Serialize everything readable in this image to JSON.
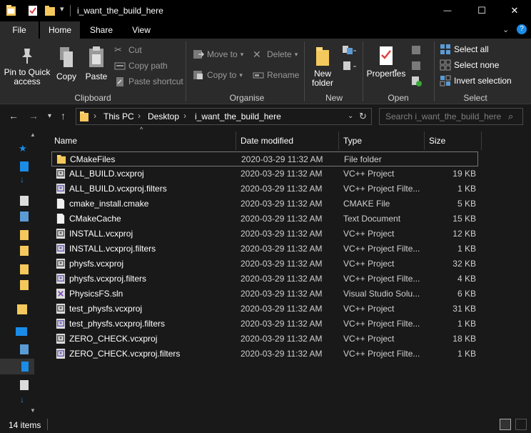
{
  "window": {
    "title": "i_want_the_build_here",
    "minimize_glyph": "—",
    "maximize_glyph": "☐",
    "close_glyph": "✕"
  },
  "ribbon_tabs": {
    "file": "File",
    "home": "Home",
    "share": "Share",
    "view": "View"
  },
  "clipboard": {
    "pin_label_1": "Pin to Quick",
    "pin_label_2": "access",
    "copy": "Copy",
    "paste": "Paste",
    "cut": "Cut",
    "copy_path": "Copy path",
    "paste_shortcut": "Paste shortcut",
    "group": "Clipboard"
  },
  "organise": {
    "move_to": "Move to",
    "copy_to": "Copy to",
    "delete": "Delete",
    "rename": "Rename",
    "group": "Organise"
  },
  "new_group": {
    "new_folder_1": "New",
    "new_folder_2": "folder",
    "group": "New"
  },
  "open_group": {
    "properties": "Properties",
    "group": "Open"
  },
  "select_group": {
    "select_all": "Select all",
    "select_none": "Select none",
    "invert_selection": "Invert selection",
    "group": "Select"
  },
  "address": {
    "crumbs": [
      "This PC",
      "Desktop",
      "i_want_the_build_here"
    ],
    "search_placeholder": "Search i_want_the_build_here"
  },
  "columns": {
    "name": "Name",
    "date_modified": "Date modified",
    "type": "Type",
    "size": "Size"
  },
  "files": [
    {
      "name": "CMakeFiles",
      "date": "2020-03-29 11:32 AM",
      "type": "File folder",
      "size": "",
      "icon": "folder-icon"
    },
    {
      "name": "ALL_BUILD.vcxproj",
      "date": "2020-03-29 11:32 AM",
      "type": "VC++ Project",
      "size": "19 KB",
      "icon": "vcxproj-icon"
    },
    {
      "name": "ALL_BUILD.vcxproj.filters",
      "date": "2020-03-29 11:32 AM",
      "type": "VC++ Project Filte...",
      "size": "1 KB",
      "icon": "filters-icon"
    },
    {
      "name": "cmake_install.cmake",
      "date": "2020-03-29 11:32 AM",
      "type": "CMAKE File",
      "size": "5 KB",
      "icon": "document-icon"
    },
    {
      "name": "CMakeCache",
      "date": "2020-03-29 11:32 AM",
      "type": "Text Document",
      "size": "15 KB",
      "icon": "document-icon"
    },
    {
      "name": "INSTALL.vcxproj",
      "date": "2020-03-29 11:32 AM",
      "type": "VC++ Project",
      "size": "12 KB",
      "icon": "vcxproj-icon"
    },
    {
      "name": "INSTALL.vcxproj.filters",
      "date": "2020-03-29 11:32 AM",
      "type": "VC++ Project Filte...",
      "size": "1 KB",
      "icon": "filters-icon"
    },
    {
      "name": "physfs.vcxproj",
      "date": "2020-03-29 11:32 AM",
      "type": "VC++ Project",
      "size": "32 KB",
      "icon": "vcxproj-icon"
    },
    {
      "name": "physfs.vcxproj.filters",
      "date": "2020-03-29 11:32 AM",
      "type": "VC++ Project Filte...",
      "size": "4 KB",
      "icon": "filters-icon"
    },
    {
      "name": "PhysicsFS.sln",
      "date": "2020-03-29 11:32 AM",
      "type": "Visual Studio Solu...",
      "size": "6 KB",
      "icon": "solution-icon"
    },
    {
      "name": "test_physfs.vcxproj",
      "date": "2020-03-29 11:32 AM",
      "type": "VC++ Project",
      "size": "31 KB",
      "icon": "vcxproj-icon"
    },
    {
      "name": "test_physfs.vcxproj.filters",
      "date": "2020-03-29 11:32 AM",
      "type": "VC++ Project Filte...",
      "size": "1 KB",
      "icon": "filters-icon"
    },
    {
      "name": "ZERO_CHECK.vcxproj",
      "date": "2020-03-29 11:32 AM",
      "type": "VC++ Project",
      "size": "18 KB",
      "icon": "vcxproj-icon"
    },
    {
      "name": "ZERO_CHECK.vcxproj.filters",
      "date": "2020-03-29 11:32 AM",
      "type": "VC++ Project Filte...",
      "size": "1 KB",
      "icon": "filters-icon"
    }
  ],
  "status": {
    "item_count": "14 items"
  },
  "colors": {
    "background": "#191919",
    "ribbon": "#2b2b2b",
    "titlebar": "#000000",
    "folder": "#f4c85c",
    "accent_blue": "#1a8ce8"
  }
}
